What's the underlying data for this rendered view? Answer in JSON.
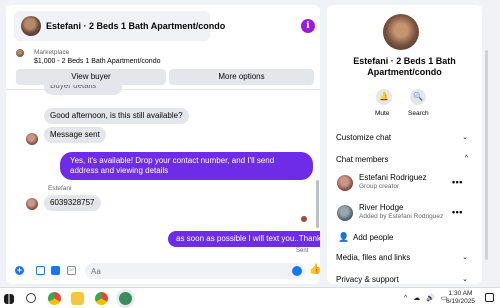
{
  "chat": {
    "header_title": "Estefani · 2 Beds 1 Bath Apartment/condo",
    "info_glyph": "i",
    "marketplace_label": "Marketplace",
    "marketplace_detail": "$1,000 - 2 Beds 1 Bath Apartment/condo",
    "view_buyer": "View buyer",
    "more_options": "More options",
    "partial_text": "Buyer details",
    "messages": [
      {
        "text": "Good afternoon, is this still available?",
        "direction": "in"
      },
      {
        "text": "Message sent",
        "direction": "in"
      },
      {
        "text": "Yes, it's available! Drop your contact number, and I'll send address and viewing details",
        "direction": "out"
      },
      {
        "text": "6039328757",
        "direction": "in",
        "sender": "Estefani"
      },
      {
        "text": "as soon as possible I will text you..Thanks",
        "direction": "out"
      }
    ],
    "sent_status": "Sent",
    "composer_placeholder": "Aa",
    "plus_glyph": "+",
    "gif_glyph": "GIF",
    "like_glyph": "👍",
    "accent_color": "#6e2ce8"
  },
  "side": {
    "title": "Estefani · 2 Beds 1 Bath Apartment/condo",
    "mute_label": "Mute",
    "search_label": "Search",
    "mute_glyph": "🔔",
    "search_glyph": "🔍",
    "customize_chat": "Customize chat",
    "chat_members": "Chat members",
    "members": [
      {
        "name": "Estefani Rodriguez",
        "role": "Group creator"
      },
      {
        "name": "River Hodge",
        "role": "Added by Estefani Rodriguez"
      }
    ],
    "more_glyph": "•••",
    "add_people": "Add people",
    "add_people_glyph": "👤",
    "media": "Media, files and links",
    "privacy": "Privacy & support",
    "chevron_down": "⌄",
    "chevron_up": "^"
  },
  "taskbar": {
    "tray": "^ ☁ 🔊 ▭",
    "time": "1:30 AM",
    "date": "6/19/2025"
  }
}
